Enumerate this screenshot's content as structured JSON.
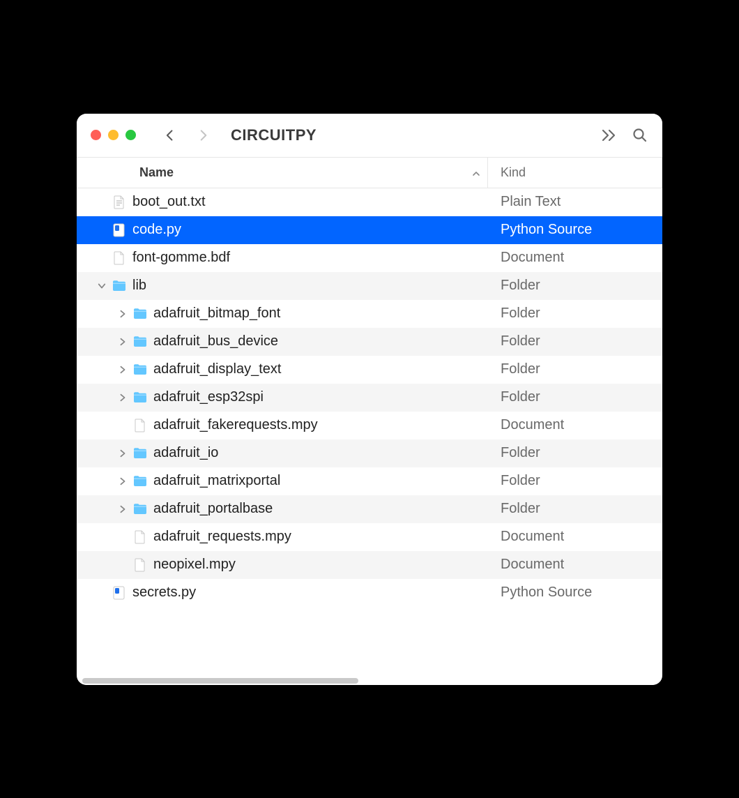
{
  "window": {
    "title": "CIRCUITPY"
  },
  "columns": {
    "name": "Name",
    "kind": "Kind"
  },
  "rows": [
    {
      "name": "boot_out.txt",
      "kind": "Plain Text",
      "icon": "txt",
      "indent": 0,
      "disclosure": "none",
      "selected": false
    },
    {
      "name": "code.py",
      "kind": "Python Source",
      "icon": "py",
      "indent": 0,
      "disclosure": "none",
      "selected": true
    },
    {
      "name": "font-gomme.bdf",
      "kind": "Document",
      "icon": "doc",
      "indent": 0,
      "disclosure": "none",
      "selected": false
    },
    {
      "name": "lib",
      "kind": "Folder",
      "icon": "folder",
      "indent": 0,
      "disclosure": "down",
      "selected": false
    },
    {
      "name": "adafruit_bitmap_font",
      "kind": "Folder",
      "icon": "folder",
      "indent": 1,
      "disclosure": "right",
      "selected": false
    },
    {
      "name": "adafruit_bus_device",
      "kind": "Folder",
      "icon": "folder",
      "indent": 1,
      "disclosure": "right",
      "selected": false
    },
    {
      "name": "adafruit_display_text",
      "kind": "Folder",
      "icon": "folder",
      "indent": 1,
      "disclosure": "right",
      "selected": false
    },
    {
      "name": "adafruit_esp32spi",
      "kind": "Folder",
      "icon": "folder",
      "indent": 1,
      "disclosure": "right",
      "selected": false
    },
    {
      "name": "adafruit_fakerequests.mpy",
      "kind": "Document",
      "icon": "doc",
      "indent": 1,
      "disclosure": "none",
      "selected": false
    },
    {
      "name": "adafruit_io",
      "kind": "Folder",
      "icon": "folder",
      "indent": 1,
      "disclosure": "right",
      "selected": false
    },
    {
      "name": "adafruit_matrixportal",
      "kind": "Folder",
      "icon": "folder",
      "indent": 1,
      "disclosure": "right",
      "selected": false
    },
    {
      "name": "adafruit_portalbase",
      "kind": "Folder",
      "icon": "folder",
      "indent": 1,
      "disclosure": "right",
      "selected": false
    },
    {
      "name": "adafruit_requests.mpy",
      "kind": "Document",
      "icon": "doc",
      "indent": 1,
      "disclosure": "none",
      "selected": false
    },
    {
      "name": "neopixel.mpy",
      "kind": "Document",
      "icon": "doc",
      "indent": 1,
      "disclosure": "none",
      "selected": false
    },
    {
      "name": "secrets.py",
      "kind": "Python Source",
      "icon": "py",
      "indent": 0,
      "disclosure": "none",
      "selected": false
    }
  ]
}
